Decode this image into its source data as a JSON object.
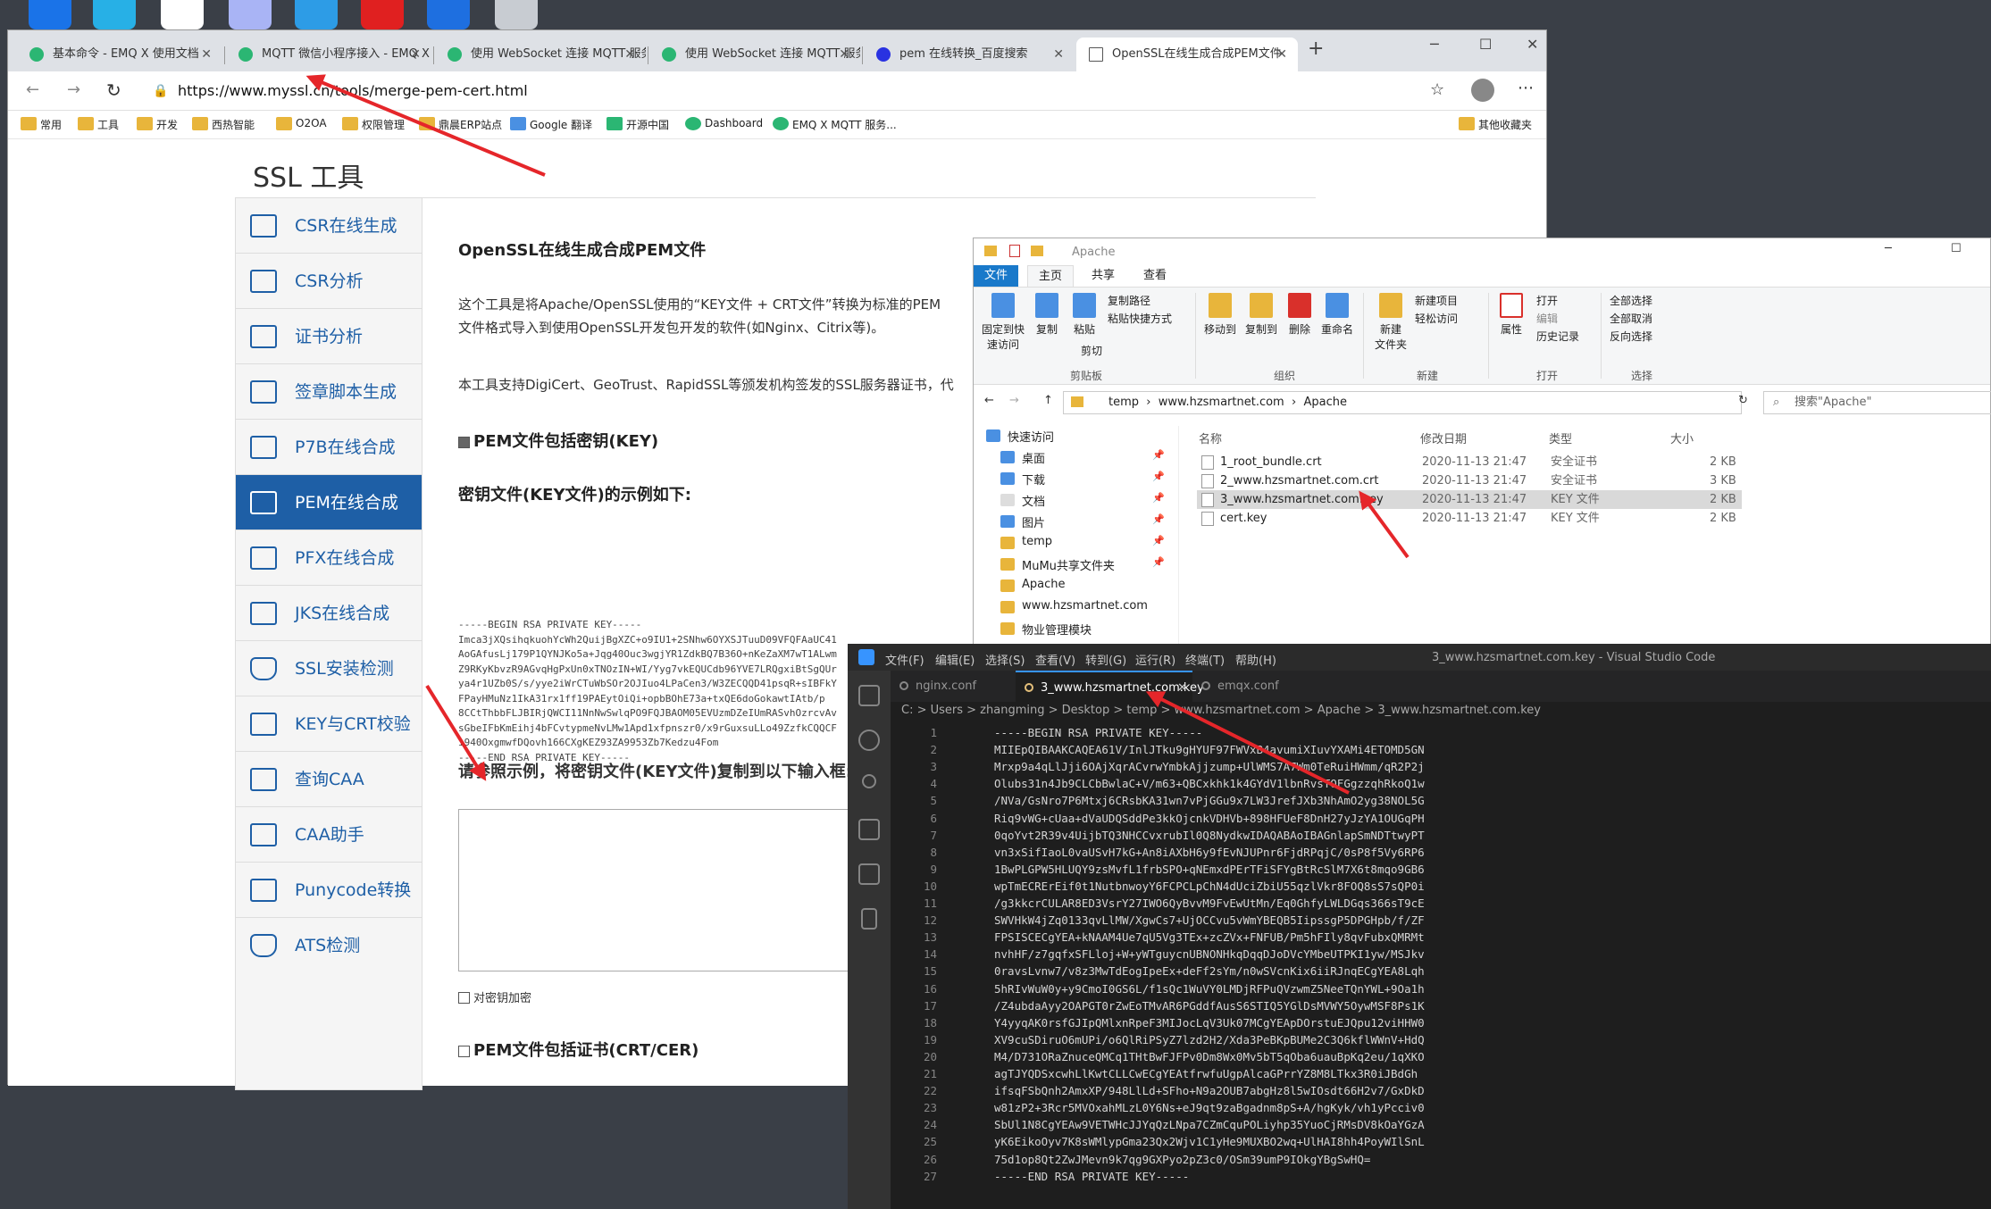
{
  "browser": {
    "tabs": [
      {
        "title": "基本命令 - EMQ X 使用文档"
      },
      {
        "title": "MQTT 微信小程序接入 - EMQ X 使"
      },
      {
        "title": "使用 WebSocket 连接 MQTT 服务"
      },
      {
        "title": "使用 WebSocket 连接 MQTT 服务"
      },
      {
        "title": "pem 在线转换_百度搜索"
      },
      {
        "title": "OpenSSL在线生成合成PEM文件"
      }
    ],
    "new_tab": "+",
    "url": "https://www.myssl.cn/tools/merge-pem-cert.html",
    "favorites": [
      "常用",
      "工具",
      "开发",
      "西热智能",
      "O2OA",
      "权限管理",
      "鼎晨ERP站点",
      "Google 翻译",
      "开源中国",
      "Dashboard",
      "EMQ X MQTT 服务...",
      "其他收藏夹"
    ]
  },
  "page": {
    "title": "SSL 工具",
    "nav": [
      "CSR在线生成",
      "CSR分析",
      "证书分析",
      "签章脚本生成",
      "P7B在线合成",
      "PEM在线合成",
      "PFX在线合成",
      "JKS在线合成",
      "SSL安装检测",
      "KEY与CRT校验",
      "查询CAA",
      "CAA助手",
      "Punycode转换",
      "ATS检测"
    ],
    "heading": "OpenSSL在线生成合成PEM文件",
    "desc1": "这个工具是将Apache/OpenSSL使用的“KEY文件 + CRT文件”转换为标准的PEM",
    "desc2": "文件格式导入到使用OpenSSL开发包开发的软件(如Nginx、Citrix等)。",
    "desc3": "本工具支持DigiCert、GeoTrust、RapidSSL等颁发机构签发的SSL服务器证书，代",
    "pem_key_label": "PEM文件包括密钥(KEY)",
    "sample_heading": "密钥文件(KEY文件)的示例如下:",
    "sample_key": "-----BEGIN RSA PRIVATE KEY-----\nImca3jXQsihqkuohYcWh2QuijBgXZC+o9IU1+2SNhw6OYXSJTuuD09VFQFAaUC41\nAoGAfusLj179P1QYNJKo5a+Jqg40Ouc3wgjYR1ZdkBQ7B36O+nKeZaXM7wT1ALwm\nZ9RKyKbvzR9AGvqHgPxUn0xTNOzIN+WI/Yyg7vkEQUCdb96YVE7LRQgxiBtSgQUr\nya4r1UZb0S/s/yye2iWrCTuWbSOr2OJIuo4LPaCen3/W3ZECQQD41psqR+sIBFkY\nFPayHMuNz1IkA31rx1ff19PAEytOiQi+opbBOhE73a+txQE6doGokawtIAtb/p\n8CCtThbbFLJBIRjQWCI11NnNwSwlqPO9FQJBAOM05EVUzmDZeIUmRASvhOzrcvAv\nsGbeIFbKmEihj4bFCvtypmeNvLMw1Apd1xfpnszr0/x9rGuxsuLLo49ZzfkCQQCF\ni940OxgmwfDQovh166CXgKEZ93ZA9953Zb7Kedzu4Fom\n-----END RSA PRIVATE KEY-----",
    "input_heading": "请参照示例，将密钥文件(KEY文件)复制到以下输入框:",
    "encrypt_label": "对密钥加密",
    "pem_crt_label": "PEM文件包括证书(CRT/CER)"
  },
  "explorer": {
    "title": "Apache",
    "tabs": [
      "文件",
      "主页",
      "共享",
      "查看"
    ],
    "ribbon": {
      "pin": "固定到快\n速访问",
      "copy": "复制",
      "paste": "粘贴",
      "copy_path": "复制路径",
      "paste_shortcut": "粘贴快捷方式",
      "cut": "剪切",
      "move_to": "移动到",
      "copy_to": "复制到",
      "delete": "删除",
      "rename": "重命名",
      "new_folder": "新建\n文件夹",
      "new_item": "新建项目",
      "easy_access": "轻松访问",
      "properties": "属性",
      "open": "打开",
      "edit": "编辑",
      "history": "历史记录",
      "select_all": "全部选择",
      "select_none": "全部取消",
      "invert": "反向选择",
      "groups": [
        "剪贴板",
        "组织",
        "新建",
        "打开",
        "选择"
      ]
    },
    "path": [
      "temp",
      "www.hzsmartnet.com",
      "Apache"
    ],
    "search_placeholder": "搜索\"Apache\"",
    "quick_access": "快速访问",
    "left_items": [
      "桌面",
      "下载",
      "文档",
      "图片",
      "temp",
      "MuMu共享文件夹",
      "Apache",
      "www.hzsmartnet.com",
      "物业管理模块"
    ],
    "columns": [
      "名称",
      "修改日期",
      "类型",
      "大小"
    ],
    "files": [
      {
        "name": "1_root_bundle.crt",
        "date": "2020-11-13 21:47",
        "type": "安全证书",
        "size": "2 KB"
      },
      {
        "name": "2_www.hzsmartnet.com.crt",
        "date": "2020-11-13 21:47",
        "type": "安全证书",
        "size": "3 KB"
      },
      {
        "name": "3_www.hzsmartnet.com.key",
        "date": "2020-11-13 21:47",
        "type": "KEY 文件",
        "size": "2 KB"
      },
      {
        "name": "cert.key",
        "date": "2020-11-13 21:47",
        "type": "KEY 文件",
        "size": "2 KB"
      }
    ]
  },
  "vscode": {
    "menu": [
      "文件(F)",
      "编辑(E)",
      "选择(S)",
      "查看(V)",
      "转到(G)",
      "运行(R)",
      "终端(T)",
      "帮助(H)"
    ],
    "title": "3_www.hzsmartnet.com.key - Visual Studio Code",
    "tabs": [
      "nginx.conf",
      "3_www.hzsmartnet.com.key",
      "emqx.conf"
    ],
    "breadcrumb": "C: > Users > zhangming > Desktop > temp > www.hzsmartnet.com > Apache > 3_www.hzsmartnet.com.key",
    "lines": [
      "-----BEGIN RSA PRIVATE KEY-----",
      "MIIEpQIBAAKCAQEA61V/InlJTku9gHYUF97FWVxB4avumiXIuvYXAMi4ETOMD5GN",
      "Mrxp9a4qLlJji6OAjXqrACvrwYmbkAjjzump+UlWMS7A7Wm0TeRuiHWmm/qR2P2j",
      "Olubs31n4Jb9CLCbBwlaC+V/m63+QBCxkhk1k4GYdV1lbnRvsTOFGgzzqhRkoQ1w",
      "/NVa/GsNro7P6Mtxj6CRsbKA31wn7vPjGGu9x7LW3JrefJXb3NhAmO2yg38NOL5G",
      "Riq9vWG+cUaa+dVaUDQSddPe3kkOjcnkVDHVb+898HFUeF8DnH27yJzYA1OUGqPH",
      "0qoYvt2R39v4UijbTQ3NHCCvxrubIl0Q8NydkwIDAQABAoIBAGnlapSmNDTtwyPT",
      "vn3xSifIaoL0vaUSvH7kG+An8iAXbH6y9fEvNJUPnr6FjdRPqjC/0sP8f5Vy6RP6",
      "1BwPLGPW5HLUQY9zsMvfL1frbSPO+qNEmxdPErTFiSFYgBtRcSlM7X6t8mqo9GB6",
      "wpTmECRErEif0t1NutbnwoyY6FCPCLpChN4dUciZbiU55qzlVkr8FOQ8sS7sQP0i",
      "/g3kkcrCULAR8ED3VsrY27IWO6QyBvvM9FvEwUtMn/Eq0GhfyLWLDGqs366sT9cE",
      "SWVHkW4jZq0133qvLlMW/XgwCs7+UjOCCvu5vWmYBEQB5IipssgP5DPGHpb/f/ZF",
      "FPSISCECgYEA+kNAAM4Ue7qU5Vg3TEx+zcZVx+FNFUB/Pm5hFIly8qvFubxQMRMt",
      "nvhHF/z7gqfxSFLloj+W+yWTguycnUBNONHkqDqqDJoDVcYMbeUTPKI1yw/MSJkv",
      "0ravsLvnw7/v8z3MwTdEogIpeEx+deFf2sYm/n0wSVcnKix6iiRJnqECgYEA8Lqh",
      "5hRIvWuW0y+y9CmoI0GS6L/f1sQc1WuVY0LMDjRFPuQVzwmZ5NeeTQnYWL+9Oa1h",
      "/Z4ubdaAyy2OAPGT0rZwEoTMvAR6PGddfAusS6STIQ5YGlDsMVWY5OywMSF8Ps1K",
      "Y4yyqAK0rsfGJIpQMlxnRpeF3MIJocLqV3Uk07MCgYEApDOrstuEJQpu12viHHW0",
      "XV9cuSDiruO6mUPi/o6QlRiPSyZ7lzd2H2/Xda3PeBKpBUMe2C3Q6kflWWnV+HdQ",
      "M4/D731ORaZnuceQMCq1THtBwFJFPv0Dm8Wx0Mv5bT5qOba6uauBpKq2eu/1qXKO",
      "agTJYQDSxcwhLlKwtCLLCwECgYEAtfrwfuUgpAlcaGPrrYZ8M8LTkx3R0iJBdGh",
      "ifsqFSbQnh2AmxXP/948LlLd+SFho+N9a2OUB7abgHz8l5wIOsdt66H2v7/GxDkD",
      "w81zP2+3Rcr5MVOxahMLzL0Y6Ns+eJ9qt9zaBgadnm8pS+A/hgKyk/vh1yPcciv0",
      "SbUl1N8CgYEAw9VETWHcJJYqQzLNpa7CZmCquPOLiyhp35YuoCjRMsDV8kOaYGzA",
      "yK6EikoOyv7K8sWMlypGma23Qx2Wjv1C1yHe9MUXBO2wq+UlHAI8hh4PoyWIlSnL",
      "75d1op8Qt2ZwJMevn9k7qg9GXPyo2pZ3c0/OSm39umP9IOkgYBgSwHQ=",
      "-----END RSA PRIVATE KEY-----"
    ]
  },
  "colors": {
    "accent": "#1e5fa6",
    "vscode_bg": "#1e1e1e",
    "explorer_accent": "#1979ca",
    "arrow": "#e5262a"
  }
}
